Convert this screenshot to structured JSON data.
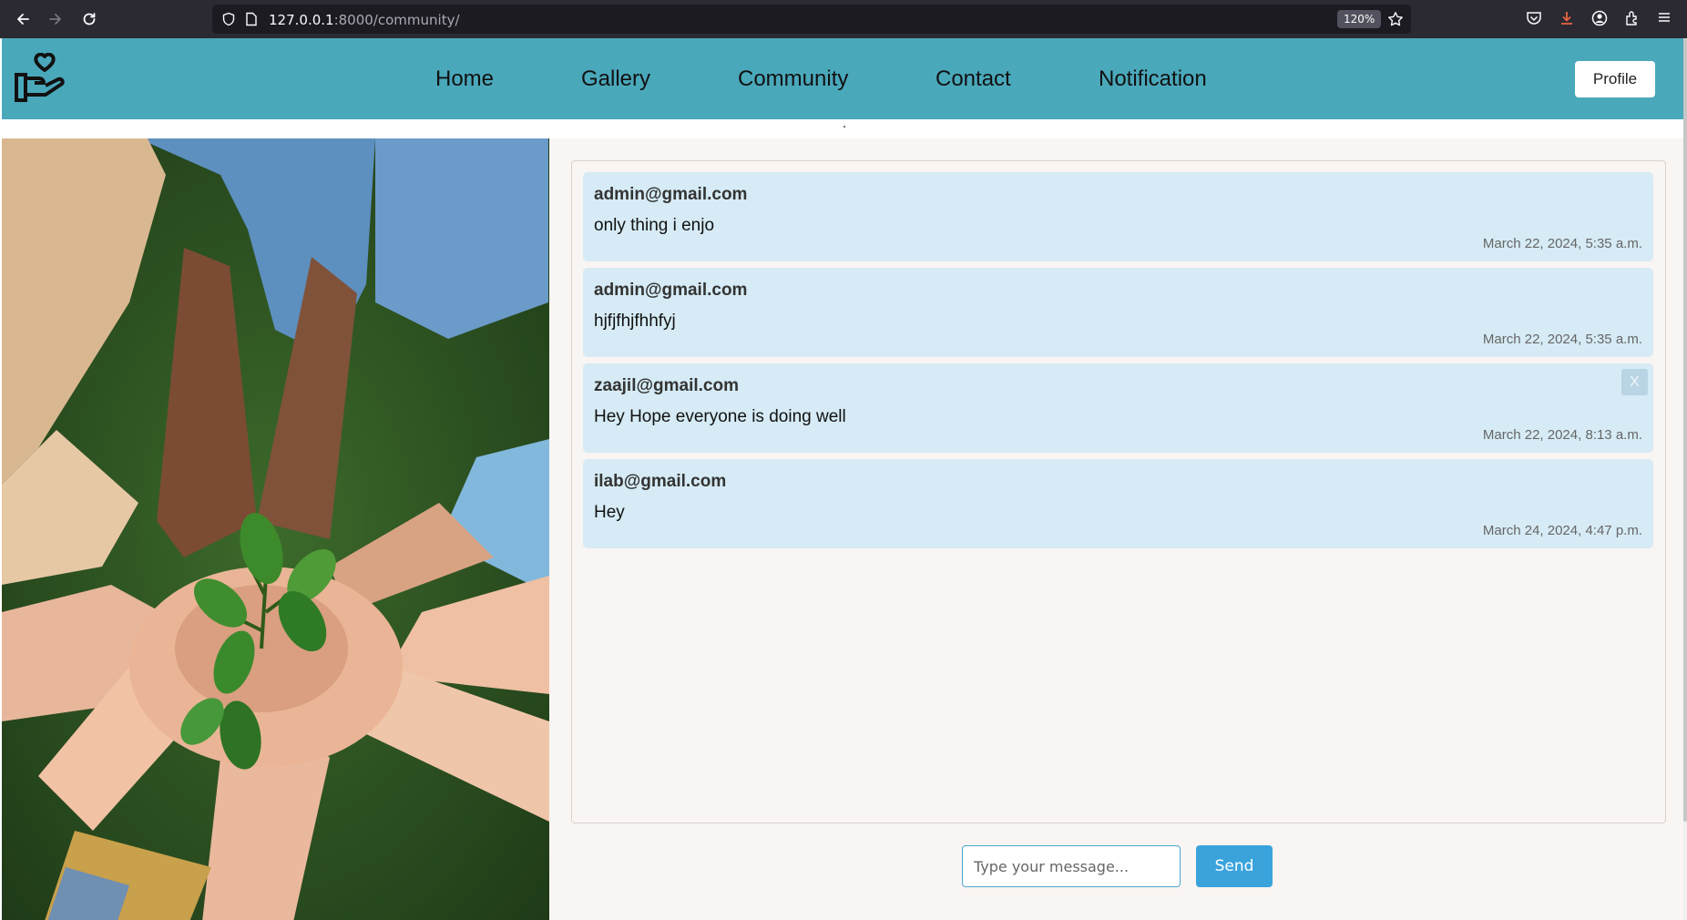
{
  "browser": {
    "url_host": "127.0.0.1",
    "url_rest": ":8000/community/",
    "zoom": "120%"
  },
  "nav": {
    "items": [
      {
        "label": "Home"
      },
      {
        "label": "Gallery"
      },
      {
        "label": "Community"
      },
      {
        "label": "Contact"
      },
      {
        "label": "Notification"
      }
    ],
    "profile_label": "Profile"
  },
  "messages": [
    {
      "sender": "admin@gmail.com",
      "body": "only thing i enjo",
      "time": "March 22, 2024, 5:35 a.m.",
      "deletable": false
    },
    {
      "sender": "admin@gmail.com",
      "body": "hjfjfhjfhhfyj",
      "time": "March 22, 2024, 5:35 a.m.",
      "deletable": false
    },
    {
      "sender": "zaajil@gmail.com",
      "body": "Hey Hope everyone is doing well",
      "time": "March 22, 2024, 8:13 a.m.",
      "deletable": true,
      "delete_label": "X"
    },
    {
      "sender": "ilab@gmail.com",
      "body": "Hey",
      "time": "March 24, 2024, 4:47 p.m.",
      "deletable": false
    }
  ],
  "composer": {
    "placeholder": "Type your message...",
    "value": "",
    "send_label": "Send"
  },
  "colors": {
    "header": "#4aa8bb",
    "message_bg": "#d6ebf5",
    "send_button": "#3aa3dc"
  }
}
